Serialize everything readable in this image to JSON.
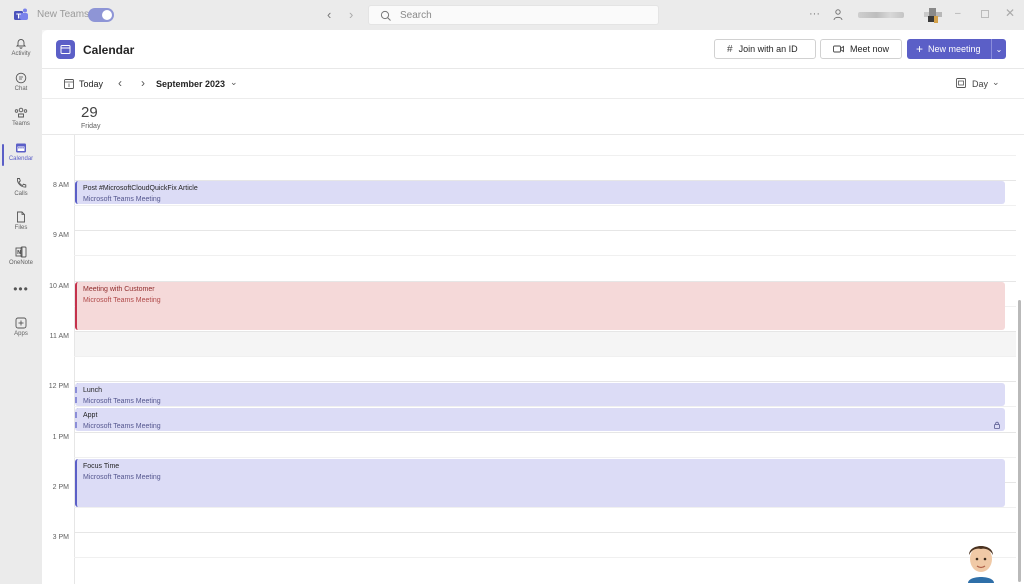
{
  "titlebar": {
    "new_teams_label": "New Teams",
    "search_placeholder": "Search",
    "more_label": "···",
    "back_glyph": "‹",
    "forward_glyph": "›",
    "minimize_glyph": "–",
    "close_glyph": "✕"
  },
  "rail": {
    "items": [
      {
        "label": "Activity",
        "icon": "bell-icon"
      },
      {
        "label": "Chat",
        "icon": "chat-icon"
      },
      {
        "label": "Teams",
        "icon": "teams-icon"
      },
      {
        "label": "Calendar",
        "icon": "calendar-icon",
        "active": true
      },
      {
        "label": "Calls",
        "icon": "phone-icon"
      },
      {
        "label": "Files",
        "icon": "file-icon"
      },
      {
        "label": "OneNote",
        "icon": "onenote-icon"
      },
      {
        "label": "Apps",
        "icon": "plus-box-icon"
      }
    ],
    "more_label": "•••"
  },
  "header": {
    "title": "Calendar",
    "join_label": "Join with an ID",
    "meet_label": "Meet now",
    "new_meeting_label": "New meeting",
    "join_glyph": "#",
    "new_glyph": "+",
    "dropdown_glyph": "⌄"
  },
  "toolbar": {
    "today_label": "Today",
    "month_label": "September 2023",
    "view_label": "Day",
    "prev_glyph": "‹",
    "next_glyph": "›",
    "dropdown_glyph": "⌄"
  },
  "day": {
    "number": "29",
    "name": "Friday"
  },
  "times": [
    "8 AM",
    "9 AM",
    "10 AM",
    "11 AM",
    "12 PM",
    "1 PM",
    "2 PM",
    "3 PM"
  ],
  "events": [
    {
      "title": "Post #MicrosoftCloudQuickFix Article",
      "subtitle": "Microsoft Teams Meeting",
      "color": "#5b5fc7"
    },
    {
      "title": "Meeting with Customer",
      "subtitle": "Microsoft Teams Meeting",
      "color": "#c4314b"
    },
    {
      "title": "Lunch",
      "subtitle": "Microsoft Teams Meeting",
      "color": "#8b8ed8"
    },
    {
      "title": "Appt",
      "subtitle": "Microsoft Teams Meeting",
      "color": "#8b8ed8"
    },
    {
      "title": "Focus Time",
      "subtitle": "Microsoft Teams Meeting",
      "color": "#5b5fc7"
    }
  ],
  "colors": {
    "accent": "#5b5fc7",
    "busy_red": "#c4314b",
    "event_bg": "#dcdcf6",
    "red_bg": "#f5d9d9"
  }
}
